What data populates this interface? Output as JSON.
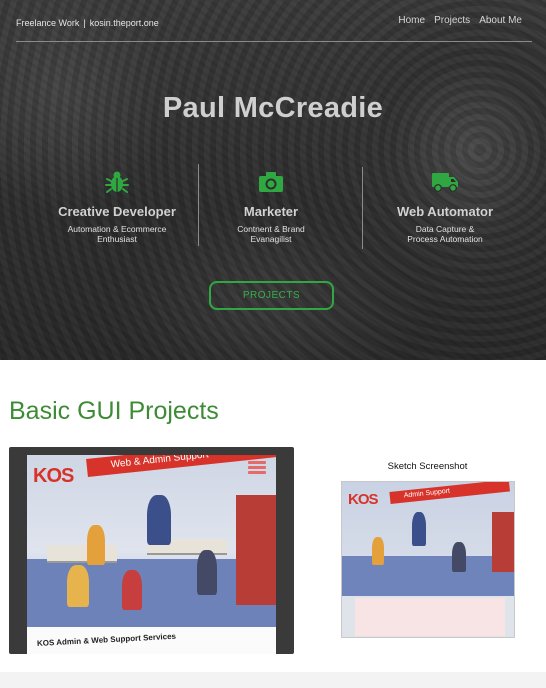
{
  "header": {
    "brand_left": "Freelance Work",
    "brand_separator": "|",
    "brand_right": "kosin.theport.one",
    "nav": [
      "Home",
      "Projects",
      "About Me"
    ]
  },
  "hero": {
    "title": "Paul McCreadie",
    "roles": [
      {
        "icon": "bug-icon",
        "title": "Creative Developer",
        "desc_line1": "Automation & Ecommerce",
        "desc_line2": "Enthusiast"
      },
      {
        "icon": "camera-icon",
        "title": "Marketer",
        "desc_line1": "Contnent & Brand",
        "desc_line2": "Evanagilist"
      },
      {
        "icon": "truck-icon",
        "title": "Web Automator",
        "desc_line1": "Data Capture &",
        "desc_line2": "Process Automation"
      }
    ],
    "button_label": "PROJECTS"
  },
  "section": {
    "title": "Basic GUI Projects",
    "card1": {
      "logo": "KOS",
      "banner": "Web & Admin Support",
      "caption": "KOS Admin & Web Support Services"
    },
    "card2": {
      "label": "Sketch Screenshot",
      "logo": "KOS",
      "banner": "Admin Support"
    }
  },
  "colors": {
    "accent_green": "#3d8c35",
    "button_green": "#2fa841",
    "brand_red": "#d7332a"
  }
}
